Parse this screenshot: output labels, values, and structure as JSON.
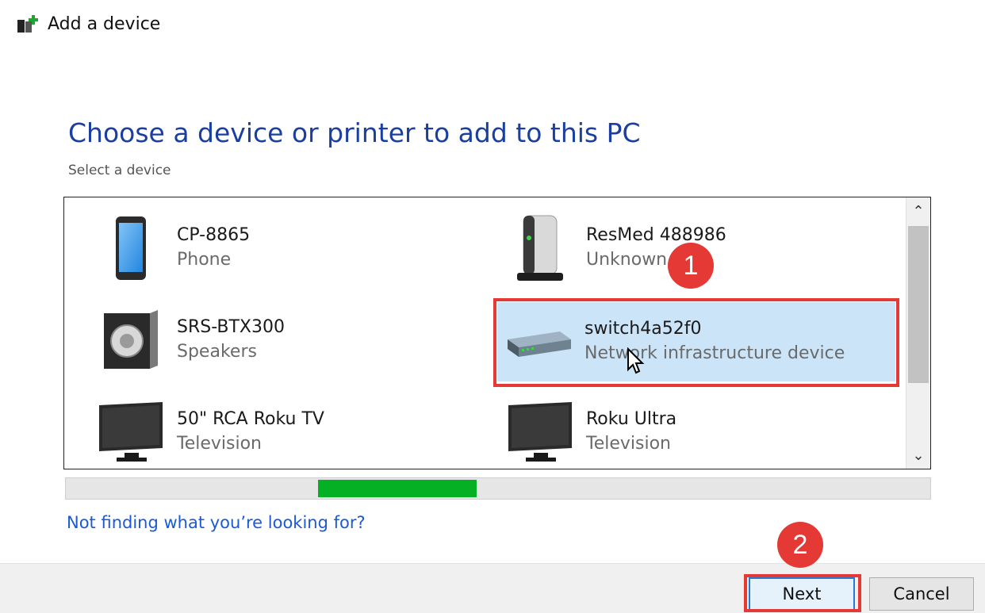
{
  "window": {
    "title": "Add a device"
  },
  "heading": "Choose a device or printer to add to this PC",
  "subheading": "Select a device",
  "devices": [
    {
      "name": "CP-8865",
      "type": "Phone",
      "icon": "phone-icon",
      "selected": false
    },
    {
      "name": "ResMed 488986",
      "type": "Unknown",
      "icon": "server-icon",
      "selected": false
    },
    {
      "name": "SRS-BTX300",
      "type": "Speakers",
      "icon": "speaker-icon",
      "selected": false
    },
    {
      "name": "switch4a52f0",
      "type": "Network infrastructure device",
      "icon": "network-switch-icon",
      "selected": true
    },
    {
      "name": "50\" RCA Roku TV",
      "type": "Television",
      "icon": "tv-icon",
      "selected": false
    },
    {
      "name": "Roku Ultra",
      "type": "Television",
      "icon": "tv-icon",
      "selected": false
    }
  ],
  "progress": {
    "label": "",
    "state": "searching"
  },
  "help_link": "Not finding what you’re looking for?",
  "buttons": {
    "next": "Next",
    "cancel": "Cancel"
  },
  "annotations": {
    "marker1": "1",
    "marker2": "2"
  },
  "colors": {
    "heading": "#1a3fa0",
    "link": "#1a5ad6",
    "selection": "#cce4f8",
    "progress": "#06b025",
    "annotation": "#e53935"
  }
}
